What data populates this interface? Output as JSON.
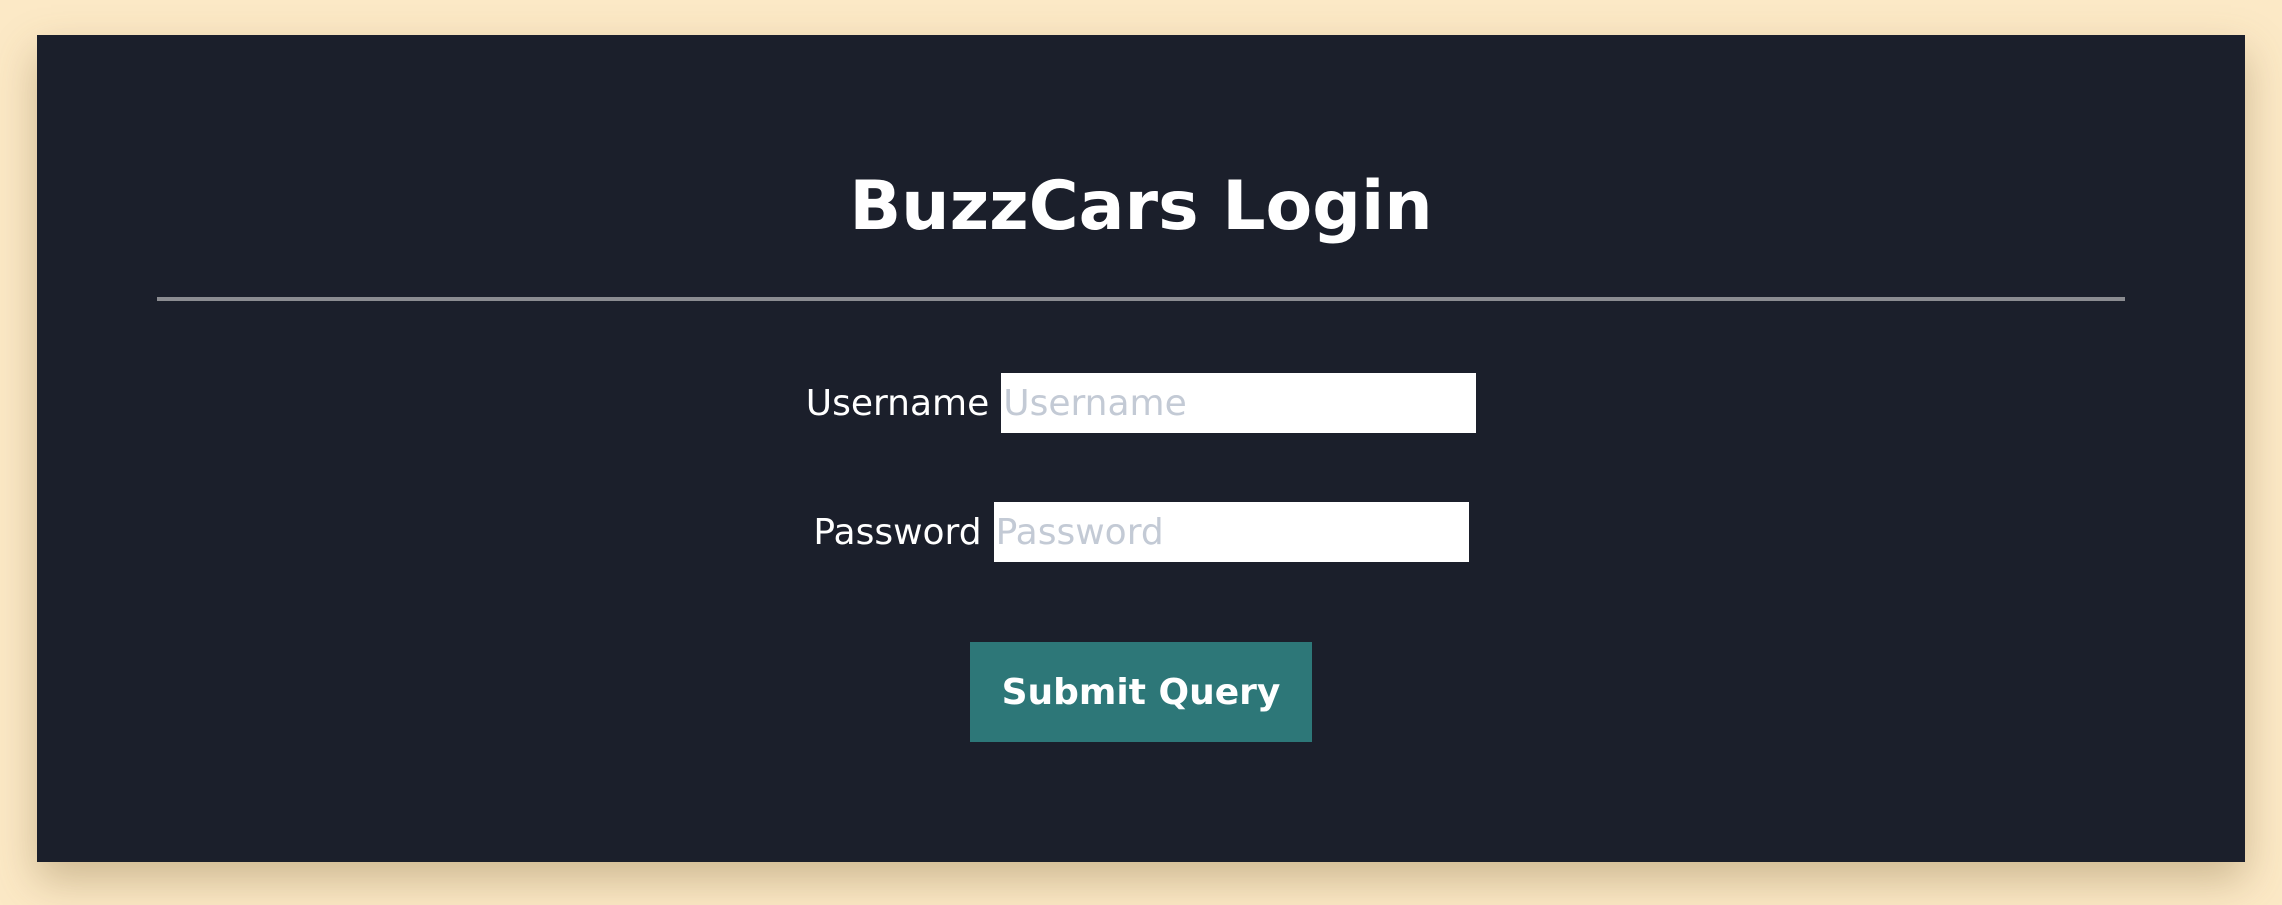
{
  "page": {
    "title": "BuzzCars Login"
  },
  "form": {
    "username": {
      "label": "Username",
      "placeholder": "Username",
      "value": ""
    },
    "password": {
      "label": "Password",
      "placeholder": "Password",
      "value": ""
    },
    "submit_label": "Submit Query"
  },
  "colors": {
    "page_background": "#fce9c6",
    "panel_background": "#1b1f2b",
    "divider": "#8b8c91",
    "button_background": "#2d7778",
    "text": "#ffffff",
    "placeholder": "#c3cad5"
  }
}
